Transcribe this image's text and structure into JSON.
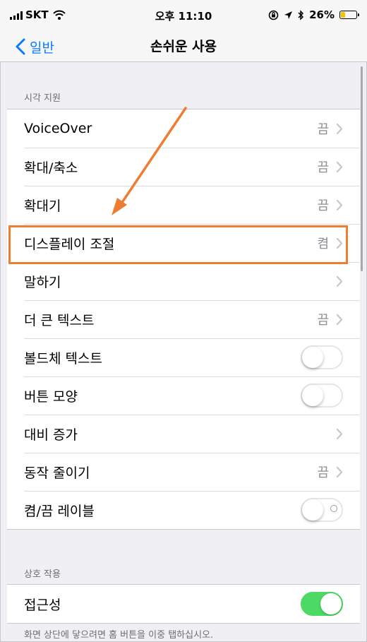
{
  "status_bar": {
    "carrier": "SKT",
    "time": "오후 11:10",
    "battery_percent": "26%",
    "battery_level": 0.26,
    "icons": [
      "signal-icon",
      "wifi-icon",
      "orientation-lock-icon",
      "location-icon",
      "bluetooth-icon",
      "battery-icon"
    ]
  },
  "nav": {
    "back_label": "일반",
    "title": "손쉬운 사용"
  },
  "vision_section": {
    "header": "시각 지원",
    "rows": [
      {
        "label": "VoiceOver",
        "value": "끔",
        "control": "chevron"
      },
      {
        "label": "확대/축소",
        "value": "끔",
        "control": "chevron"
      },
      {
        "label": "확대기",
        "value": "끔",
        "control": "chevron"
      },
      {
        "label": "디스플레이 조절",
        "value": "켬",
        "control": "chevron",
        "highlighted": true
      },
      {
        "label": "말하기",
        "value": "",
        "control": "chevron"
      },
      {
        "label": "더 큰 텍스트",
        "value": "끔",
        "control": "chevron"
      },
      {
        "label": "볼드체 텍스트",
        "control": "toggle",
        "on": false
      },
      {
        "label": "버튼 모양",
        "control": "toggle",
        "on": false
      },
      {
        "label": "대비 증가",
        "value": "",
        "control": "chevron"
      },
      {
        "label": "동작 줄이기",
        "value": "끔",
        "control": "chevron"
      },
      {
        "label": "켬/끔 레이블",
        "control": "toggle",
        "on": false
      }
    ]
  },
  "interaction_section": {
    "header": "상호 작용",
    "rows": [
      {
        "label": "접근성",
        "control": "toggle",
        "on": true
      }
    ],
    "footer": "화면 상단에 닿으려면 홈 버튼을 이중 탭하십시오."
  },
  "colors": {
    "accent": "#0a7aff",
    "toggle_on": "#4cd964",
    "annotation": "#ed7d31"
  }
}
